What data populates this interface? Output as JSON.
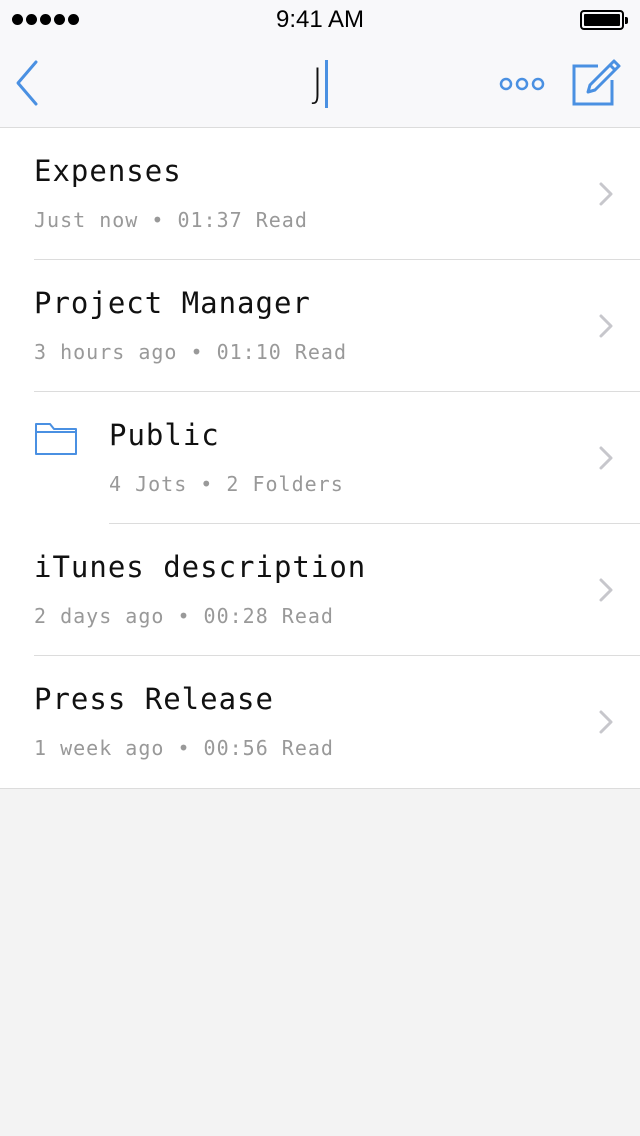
{
  "status_bar": {
    "time": "9:41 AM"
  },
  "nav": {
    "title": "J",
    "back_icon": "chevron-left-icon",
    "more_icon": "more-dots-icon",
    "compose_icon": "compose-icon"
  },
  "colors": {
    "accent": "#4a90e2",
    "meta_text": "#999999",
    "chevron": "#c7c7cc",
    "background": "#f3f3f3"
  },
  "items": [
    {
      "title": "Expenses",
      "meta": "Just now • 01:37 Read"
    },
    {
      "title": "Project Manager",
      "meta": "3 hours ago • 01:10 Read"
    },
    {
      "title": "Public",
      "meta": "4 Jots • 2 Folders",
      "icon": "folder-icon"
    },
    {
      "title": "iTunes description",
      "meta": "2 days ago • 00:28 Read"
    },
    {
      "title": "Press Release",
      "meta": "1 week ago • 00:56 Read"
    }
  ]
}
